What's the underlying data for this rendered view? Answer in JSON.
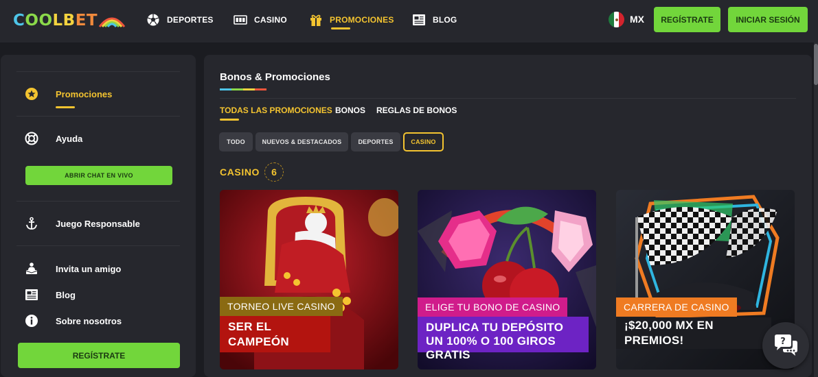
{
  "header": {
    "logo_text": "COOLBET",
    "nav": [
      {
        "label": "DEPORTES",
        "icon": "soccer-ball-icon"
      },
      {
        "label": "CASINO",
        "icon": "slot-machine-icon"
      },
      {
        "label": "PROMOCIONES",
        "icon": "gift-icon",
        "active": true
      },
      {
        "label": "BLOG",
        "icon": "newspaper-icon"
      }
    ],
    "language": "MX",
    "register_label": "REGÍSTRATE",
    "login_label": "INICIAR SESIÓN"
  },
  "sidebar": {
    "items": [
      {
        "label": "Promociones",
        "icon": "star-icon",
        "active": true
      },
      {
        "label": "Ayuda",
        "icon": "lifebuoy-icon"
      },
      {
        "label": "Juego Responsable",
        "icon": "anchor-icon"
      },
      {
        "label": "Invita un amigo",
        "icon": "invite-friend-icon"
      },
      {
        "label": "Blog",
        "icon": "newspaper-icon"
      },
      {
        "label": "Sobre nosotros",
        "icon": "info-icon"
      }
    ],
    "chat_button_label": "ABRIR CHAT EN VIVO",
    "register_label": "REGÍSTRATE"
  },
  "main": {
    "title": "Bonos & Promociones",
    "tabs": [
      {
        "label": "TODAS LAS PROMOCIONES",
        "active": true
      },
      {
        "label": "BONOS"
      },
      {
        "label": "REGLAS DE BONOS"
      }
    ],
    "filters": [
      {
        "label": "TODO"
      },
      {
        "label": "NUEVOS & DESTACADOS"
      },
      {
        "label": "DEPORTES"
      },
      {
        "label": "CASINO",
        "active": true
      }
    ],
    "section_label": "CASINO",
    "section_count": "6",
    "cards": [
      {
        "tag": "TORNEO LIVE CASINO",
        "tag_color": "#8a6a12",
        "headline": "SER EL CAMPEÓN",
        "headline_color": "#b3140f"
      },
      {
        "tag": "ELIGE TU BONO DE CASINO",
        "tag_color": "#d01c8b",
        "headline": "DUPLICA TU DEPÓSITO\nUN 100% O 100 GIROS GRATIS",
        "headline_color": "#6d23c4"
      },
      {
        "tag": "CARRERA DE CASINO",
        "tag_color": "#ef7b22",
        "headline": "¡$20,000 MX EN PREMIOS!",
        "headline_color": "#1c1d22"
      }
    ]
  },
  "colors": {
    "accent": "#f4c430",
    "green": "#72d63b",
    "panel": "#26272d",
    "background": "#1b1c21"
  }
}
